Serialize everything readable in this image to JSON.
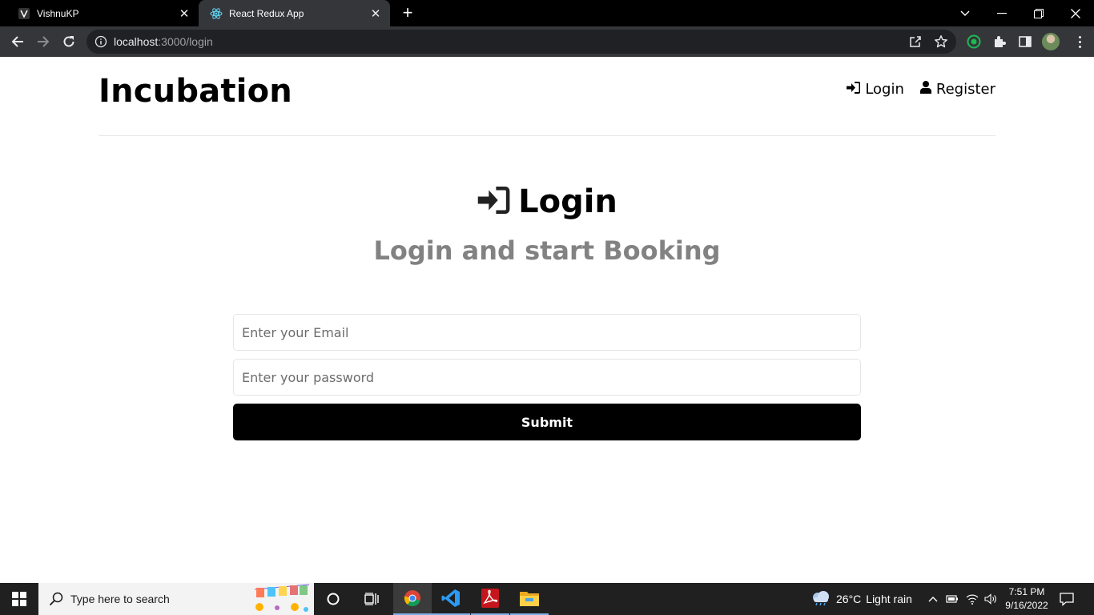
{
  "browser": {
    "tabs": [
      {
        "title": "VishnuKP",
        "active": false
      },
      {
        "title": "React Redux App",
        "active": true
      }
    ],
    "url": {
      "host": "localhost",
      "path": ":3000/login"
    }
  },
  "page": {
    "brand": "Incubation",
    "nav": {
      "login": "Login",
      "register": "Register"
    },
    "heading": "Login",
    "subheading": "Login and start Booking",
    "form": {
      "email_placeholder": "Enter your Email",
      "password_placeholder": "Enter your password",
      "submit_label": "Submit"
    }
  },
  "taskbar": {
    "search_placeholder": "Type here to search",
    "weather": {
      "temp": "26°C",
      "condition": "Light rain"
    },
    "clock": {
      "time": "7:51 PM",
      "date": "9/16/2022"
    }
  },
  "colors": {
    "tabstrip": "#000000",
    "toolbar": "#35363a",
    "subheading": "#828282",
    "submit_bg": "#000000",
    "taskbar": "#202020"
  }
}
